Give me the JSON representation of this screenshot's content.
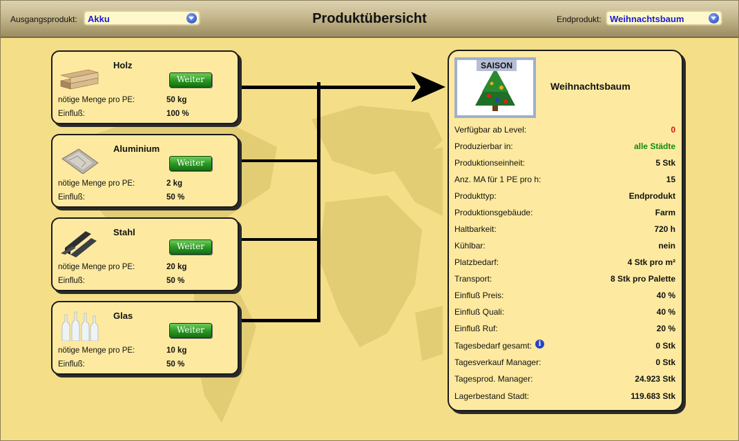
{
  "header": {
    "title": "Produktübersicht",
    "source_label": "Ausgangsprodukt:",
    "source_value": "Akku",
    "target_label": "Endprodukt:",
    "target_value": "Weihnachtsbaum"
  },
  "ingredients": [
    {
      "name": "Holz",
      "button": "Weiter",
      "qty_label": "nötige Menge pro PE:",
      "qty": "50 kg",
      "influence_label": "Einfluß:",
      "influence": "100 %"
    },
    {
      "name": "Aluminium",
      "button": "Weiter",
      "qty_label": "nötige Menge pro PE:",
      "qty": "2 kg",
      "influence_label": "Einfluß:",
      "influence": "50 %"
    },
    {
      "name": "Stahl",
      "button": "Weiter",
      "qty_label": "nötige Menge pro PE:",
      "qty": "20 kg",
      "influence_label": "Einfluß:",
      "influence": "50 %"
    },
    {
      "name": "Glas",
      "button": "Weiter",
      "qty_label": "nötige Menge pro PE:",
      "qty": "10 kg",
      "influence_label": "Einfluß:",
      "influence": "50 %"
    }
  ],
  "product": {
    "badge": "SAISON",
    "name": "Weihnachtsbaum",
    "rows": [
      {
        "label": "Verfügbar ab Level:",
        "value": "0",
        "color": "#e01010"
      },
      {
        "label": "Produzierbar in:",
        "value": "alle Städte",
        "color": "#138a13"
      },
      {
        "label": "Produktionseinheit:",
        "value": "5 Stk"
      },
      {
        "label": "Anz. MA für 1 PE pro h:",
        "value": "15"
      },
      {
        "label": "Produkttyp:",
        "value": "Endprodukt"
      },
      {
        "label": "Produktionsgebäude:",
        "value": "Farm"
      },
      {
        "label": "Haltbarkeit:",
        "value": "720 h"
      },
      {
        "label": "Kühlbar:",
        "value": "nein"
      },
      {
        "label": "Platzbedarf:",
        "value": "4 Stk pro m²"
      },
      {
        "label": "Transport:",
        "value": "8 Stk pro Palette"
      },
      {
        "label": "Einfluß Preis:",
        "value": "40 %"
      },
      {
        "label": "Einfluß Quali:",
        "value": "40 %"
      },
      {
        "label": "Einfluß Ruf:",
        "value": "20 %"
      },
      {
        "label": "Tagesbedarf gesamt:",
        "value": "0 Stk",
        "info": "i"
      },
      {
        "label": "Tagesverkauf Manager:",
        "value": "0 Stk"
      },
      {
        "label": "Tagesprod. Manager:",
        "value": "24.923 Stk"
      },
      {
        "label": "Lagerbestand Stadt:",
        "value": "119.683 Stk"
      }
    ]
  },
  "colors": {
    "background": "#f4df88",
    "card": "#fdeaa0",
    "button": "#2d9a26",
    "link_blue": "#1a1ad8"
  }
}
